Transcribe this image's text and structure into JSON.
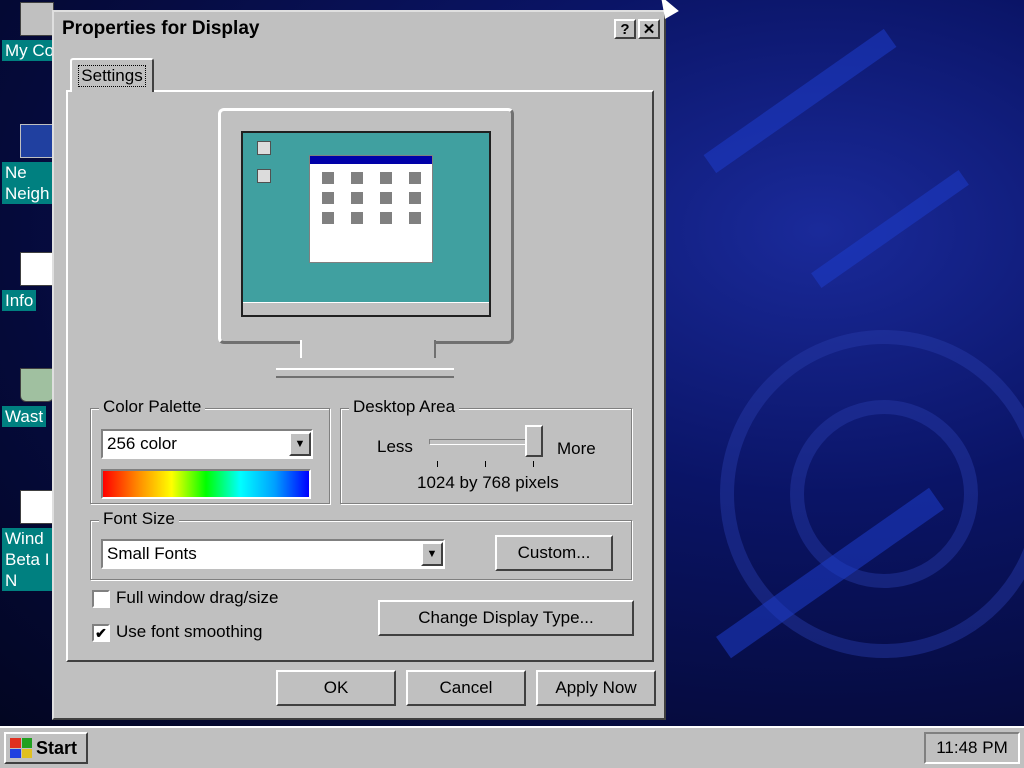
{
  "desktop": {
    "icons": [
      {
        "label": "My Co"
      },
      {
        "label": "Ne Neigh"
      },
      {
        "label": "Info"
      },
      {
        "label": "Wast"
      },
      {
        "label": "Wind Beta I N"
      }
    ]
  },
  "window": {
    "title": "Properties for Display",
    "help_label": "?",
    "close_label": "✕",
    "tab_label": "Settings",
    "color_palette": {
      "legend": "Color Palette",
      "selected": "256 color"
    },
    "desktop_area": {
      "legend": "Desktop Area",
      "less_label": "Less",
      "more_label": "More",
      "value_text": "1024 by 768 pixels",
      "slider_fraction": 1.0
    },
    "font_size": {
      "legend": "Font Size",
      "selected": "Small Fonts",
      "custom_label": "Custom..."
    },
    "checkboxes": [
      {
        "label": "Full window drag/size",
        "checked": false
      },
      {
        "label": "Use font smoothing",
        "checked": true
      }
    ],
    "change_display_type_label": "Change Display Type...",
    "buttons": {
      "ok": "OK",
      "cancel": "Cancel",
      "apply": "Apply Now"
    }
  },
  "taskbar": {
    "start_label": "Start",
    "clock": "11:48 PM"
  },
  "icons": {
    "dropdown": "chevron-down-icon",
    "check": "checkmark-icon"
  },
  "colors": {
    "desktop_teal": "#008080",
    "window_face": "#c0c0c0",
    "titlebar": "#c0c0c0"
  }
}
